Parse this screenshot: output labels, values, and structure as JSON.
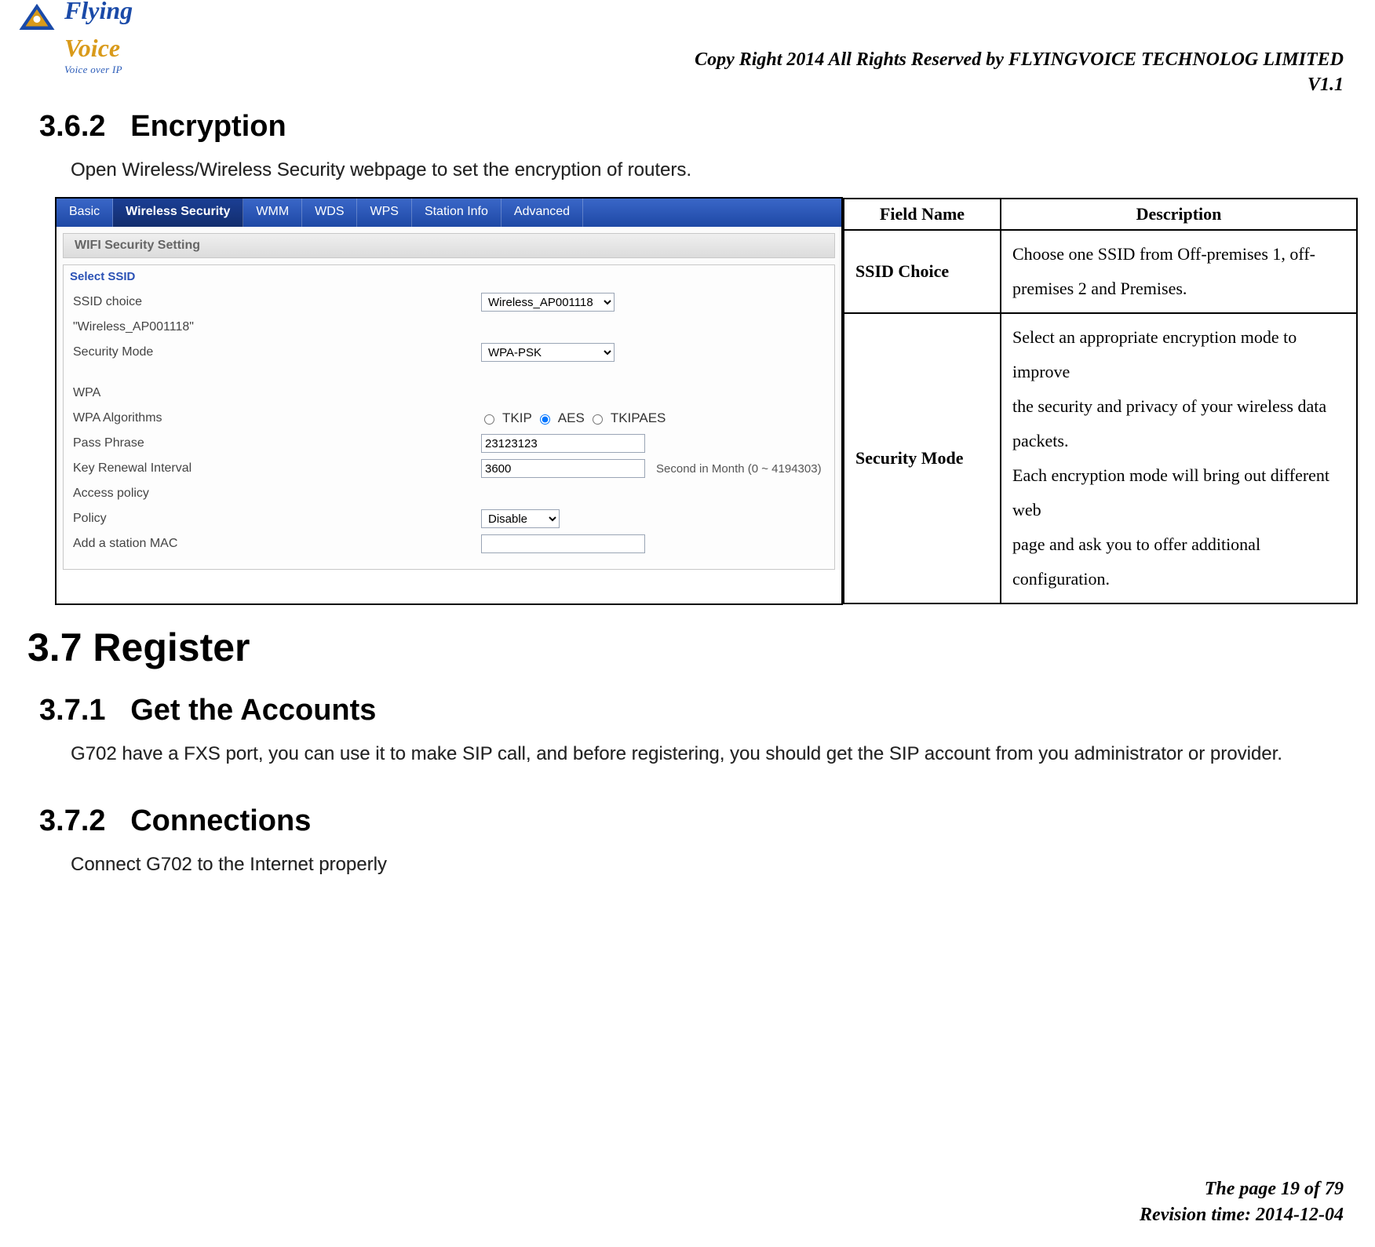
{
  "header": {
    "brand_line1": "Flying",
    "brand_line2": "Voice",
    "brand_sub": "Voice over IP",
    "copyright": "Copy Right 2014 All Rights Reserved by FLYINGVOICE TECHNOLOG LIMITED",
    "version": "V1.1"
  },
  "sections": {
    "s362_num": "3.6.2",
    "s362_title": "Encryption",
    "s362_sub": "Open Wireless/Wireless Security webpage to set the encryption of routers.",
    "s37_num": "3.7",
    "s37_title": "Register",
    "s371_num": "3.7.1",
    "s371_title": "Get the Accounts",
    "s371_sub": "G702 have a FXS port, you can use it to make SIP call, and before registering, you should get the SIP account from you administrator or provider.",
    "s372_num": "3.7.2",
    "s372_title": "Connections",
    "s372_sub": "Connect G702 to the Internet properly"
  },
  "router_ui": {
    "tabs": [
      "Basic",
      "Wireless Security",
      "WMM",
      "WDS",
      "WPS",
      "Station Info",
      "Advanced"
    ],
    "active_tab_index": 1,
    "subheader": "WIFI Security Setting",
    "legend": "Select SSID",
    "rows": {
      "ssid_choice_label": "SSID choice",
      "ssid_choice_value": "Wireless_AP001118",
      "ssid_quoted": "\"Wireless_AP001118\"",
      "security_mode_label": "Security Mode",
      "security_mode_value": "WPA-PSK",
      "wpa_label": "WPA",
      "wpa_algo_label": "WPA Algorithms",
      "algo_tkip": "TKIP",
      "algo_aes": "AES",
      "algo_tkipaes": "TKIPAES",
      "pass_phrase_label": "Pass Phrase",
      "pass_phrase_value": "23123123",
      "key_renewal_label": "Key Renewal Interval",
      "key_renewal_value": "3600",
      "key_renewal_after": "Second in Month   (0 ~ 4194303)",
      "access_policy_label": "Access policy",
      "policy_label": "Policy",
      "policy_value": "Disable",
      "add_mac_label": "Add a station MAC",
      "add_mac_value": ""
    }
  },
  "desc_table": {
    "header_field": "Field Name",
    "header_desc": "Description",
    "rows": [
      {
        "field": "SSID Choice",
        "desc": "Choose one SSID from Off-premises 1, off-premises 2 and Premises."
      },
      {
        "field": "Security Mode",
        "desc": "Select an appropriate encryption mode to improve\nthe security and privacy of your wireless data packets.\nEach encryption mode will bring out different web\npage and ask you to offer additional configuration."
      }
    ]
  },
  "footer": {
    "page_line": "The page 19 of 79",
    "rev_line": "Revision time: 2014-12-04"
  }
}
